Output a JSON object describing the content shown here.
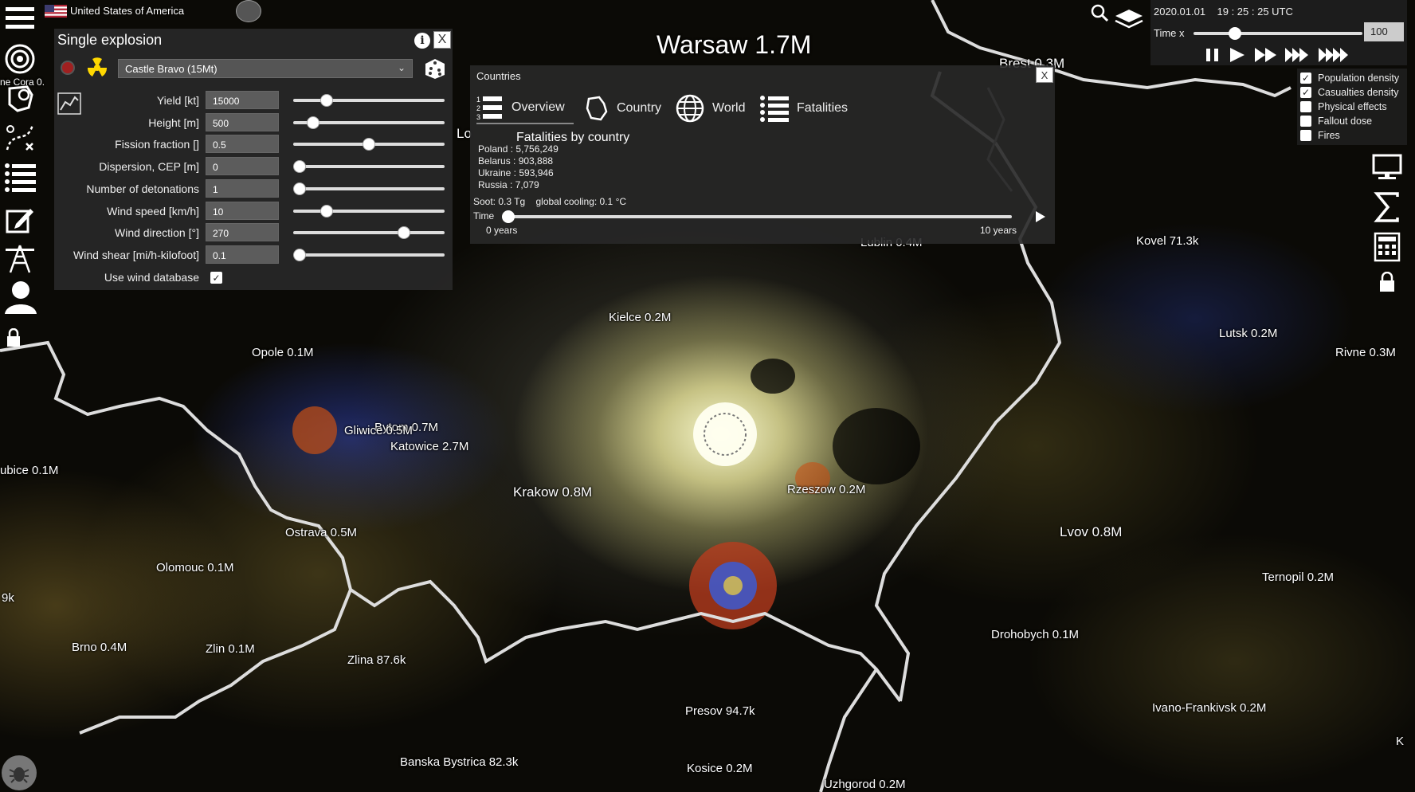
{
  "top_bar": {
    "country": "United States of America"
  },
  "explosion_panel": {
    "title": "Single explosion",
    "weapon": "Castle Bravo (15Mt)",
    "params": [
      {
        "label": "Yield [kt]",
        "value": "15000",
        "slider": 0.22
      },
      {
        "label": "Height [m]",
        "value": "500",
        "slider": 0.13
      },
      {
        "label": "Fission fraction []",
        "value": "0.5",
        "slider": 0.5
      },
      {
        "label": "Dispersion, CEP [m]",
        "value": "0",
        "slider": 0.04
      },
      {
        "label": "Number of detonations",
        "value": "1",
        "slider": 0.04
      },
      {
        "label": "Wind speed [km/h]",
        "value": "10",
        "slider": 0.22
      },
      {
        "label": "Wind direction [°]",
        "value": "270",
        "slider": 0.73
      },
      {
        "label": "Wind shear [mi/h-kilofoot]",
        "value": "0.1",
        "slider": 0.04
      }
    ],
    "wind_db_label": "Use wind database",
    "wind_db_checked": true,
    "close_label": "X",
    "info_label": "i"
  },
  "countries_panel": {
    "header": "Countries",
    "close_label": "X",
    "tabs": [
      "Overview",
      "Country",
      "World",
      "Fatalities"
    ],
    "fatalities_title": "Fatalities by country",
    "fatalities": [
      "Poland : 5,756,249",
      "Belarus : 903,888",
      "Ukraine : 593,946",
      "Russia : 7,079"
    ],
    "soot": "Soot: 0.3 Tg    global cooling: 0.1 °C",
    "time_label": "Time",
    "time_start": "0 years",
    "time_end": "10 years"
  },
  "time_panel": {
    "datetime": "2020.01.01    19 : 25 : 25 UTC",
    "timex_label": "Time x",
    "timex_value": "100"
  },
  "layers": [
    {
      "label": "Population density",
      "checked": true
    },
    {
      "label": "Casualties density",
      "checked": true
    },
    {
      "label": "Physical effects",
      "checked": false
    },
    {
      "label": "Fallout dose",
      "checked": false
    },
    {
      "label": "Fires",
      "checked": false
    }
  ],
  "cities": {
    "warsaw": "Warsaw 1.7M",
    "brest": "Brest 0.3M",
    "kovel": "Kovel 71.3k",
    "lutsk": "Lutsk 0.2M",
    "rivne": "Rivne 0.3M",
    "kielce": "Kielce 0.2M",
    "opole": "Opole 0.1M",
    "bytom": "Bytom 0.7M",
    "gliwice": "Gliwice 0.5M",
    "katowice": "Katowice 2.7M",
    "krakow": "Krakow 0.8M",
    "rzeszow": "Rzeszow 0.2M",
    "lvov": "Lvov 0.8M",
    "ostrava": "Ostrava 0.5M",
    "olomouc": "Olomouc 0.1M",
    "ternopil": "Ternopil 0.2M",
    "drohobych": "Drohobych 0.1M",
    "brno": "Brno 0.4M",
    "zlin": "Zlin 0.1M",
    "zlina": "Zlina 87.6k",
    "presov": "Presov 94.7k",
    "ivano": "Ivano-Frankivsk 0.2M",
    "banska": "Banska Bystrica 82.3k",
    "kosice": "Kosice 0.2M",
    "uzhgorod": "Uzhgorod 0.2M",
    "lubice": "ubice 0.1M",
    "edge_9k": "9k",
    "lo": "Lo",
    "edge_k": "K",
    "lublin": "Lublin 0.4M",
    "edge_lodz": "ne Cora 0."
  }
}
